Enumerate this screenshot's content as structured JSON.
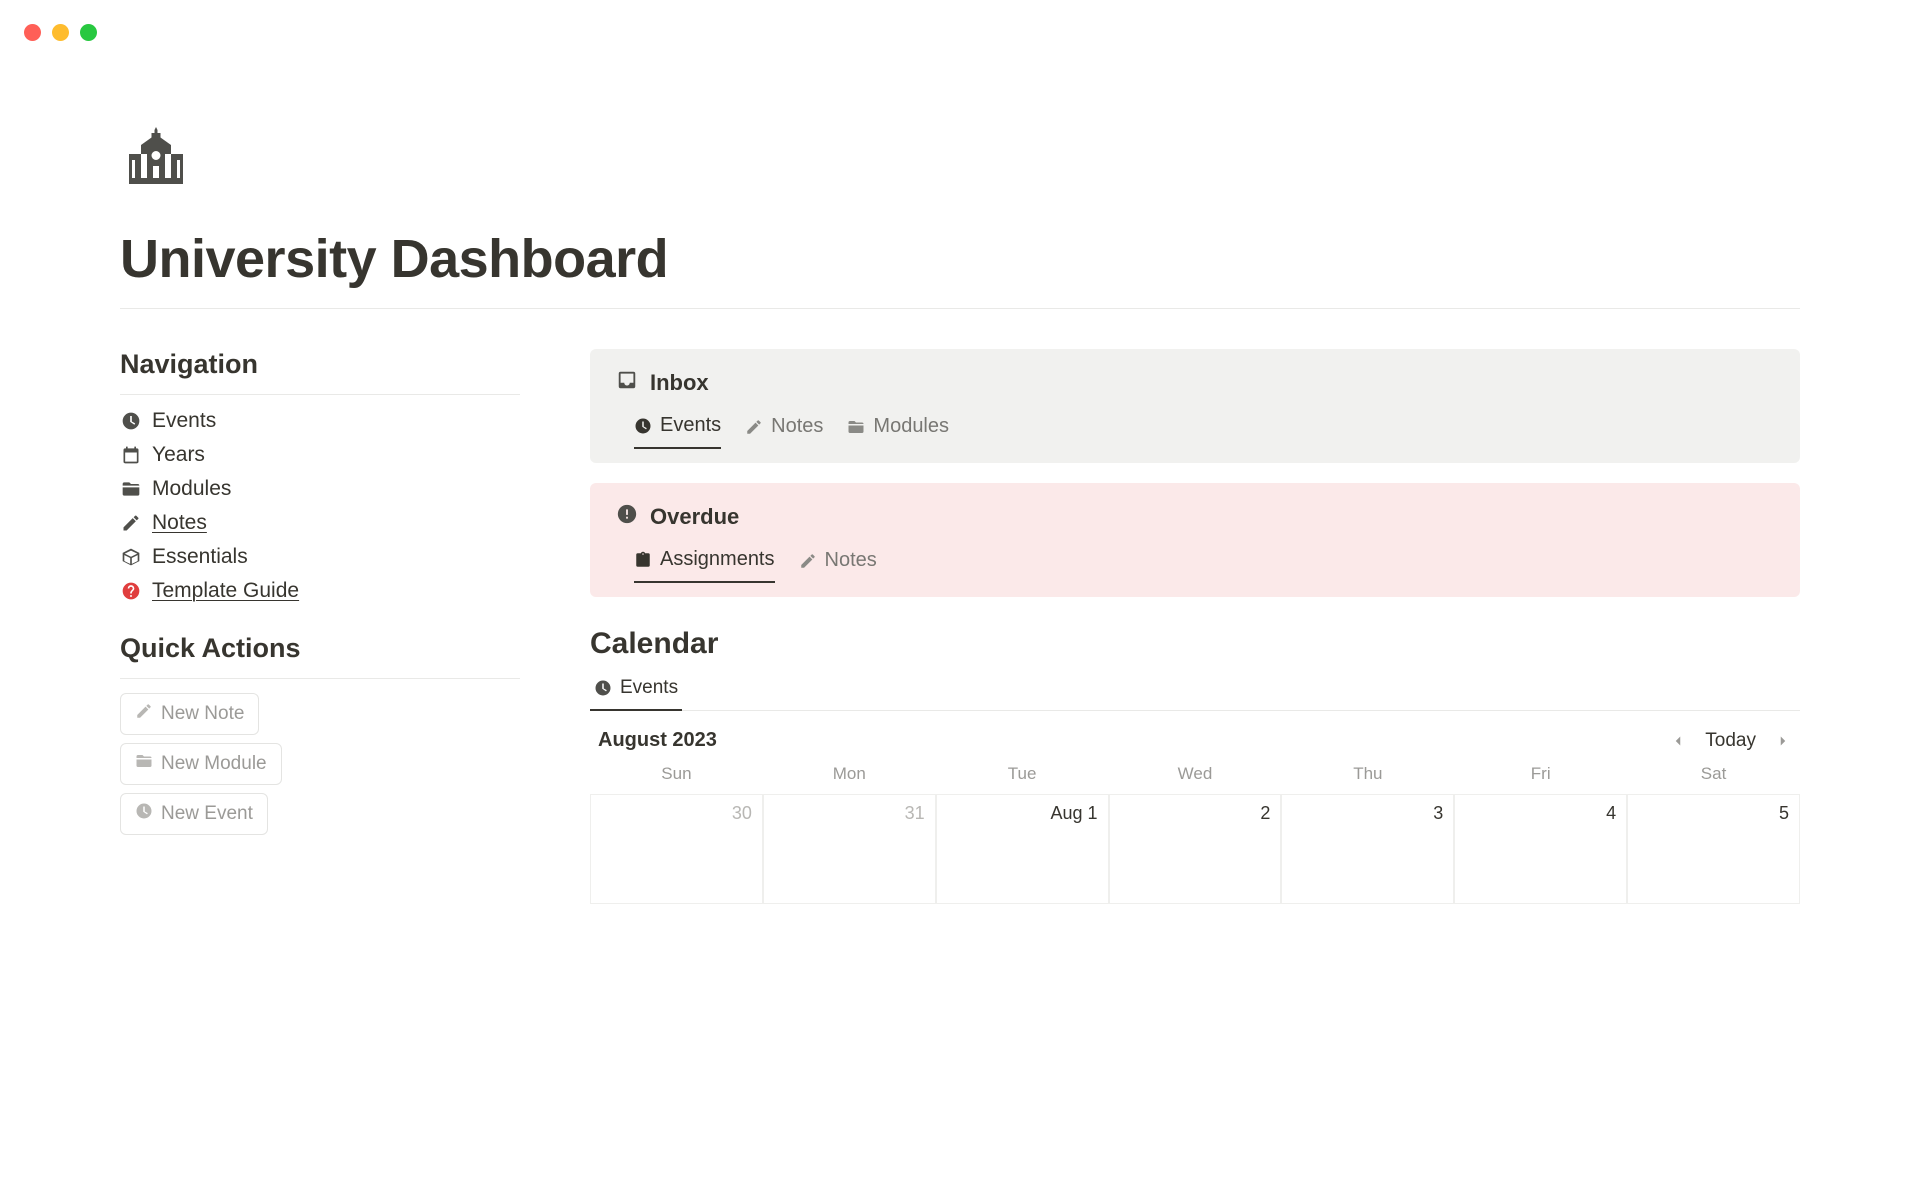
{
  "page": {
    "title": "University Dashboard"
  },
  "sidebar": {
    "navigation_heading": "Navigation",
    "nav_items": [
      {
        "label": "Events",
        "icon": "clock"
      },
      {
        "label": "Years",
        "icon": "calendar"
      },
      {
        "label": "Modules",
        "icon": "folder"
      },
      {
        "label": "Notes",
        "icon": "pencil",
        "underlined": true
      },
      {
        "label": "Essentials",
        "icon": "box"
      },
      {
        "label": "Template Guide",
        "icon": "question-red"
      }
    ],
    "quick_actions_heading": "Quick Actions",
    "quick_actions": [
      {
        "label": "New Note",
        "icon": "pencil"
      },
      {
        "label": "New Module",
        "icon": "folder"
      },
      {
        "label": "New Event",
        "icon": "clock"
      }
    ]
  },
  "inbox": {
    "title": "Inbox",
    "tabs": [
      {
        "label": "Events",
        "icon": "clock",
        "active": true
      },
      {
        "label": "Notes",
        "icon": "pencil",
        "active": false
      },
      {
        "label": "Modules",
        "icon": "folder",
        "active": false
      }
    ]
  },
  "overdue": {
    "title": "Overdue",
    "tabs": [
      {
        "label": "Assignments",
        "icon": "clipboard",
        "active": true
      },
      {
        "label": "Notes",
        "icon": "pencil",
        "active": false
      }
    ]
  },
  "calendar": {
    "heading": "Calendar",
    "tab_label": "Events",
    "month_label": "August 2023",
    "today_label": "Today",
    "day_headers": [
      "Sun",
      "Mon",
      "Tue",
      "Wed",
      "Thu",
      "Fri",
      "Sat"
    ],
    "cells": [
      {
        "label": "30",
        "muted": true
      },
      {
        "label": "31",
        "muted": true
      },
      {
        "label": "Aug 1",
        "muted": false
      },
      {
        "label": "2",
        "muted": false
      },
      {
        "label": "3",
        "muted": false
      },
      {
        "label": "4",
        "muted": false
      },
      {
        "label": "5",
        "muted": false
      }
    ]
  }
}
